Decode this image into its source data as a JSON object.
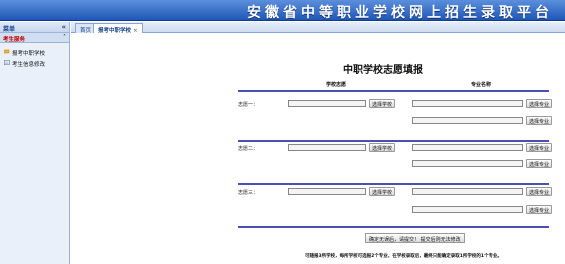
{
  "banner": {
    "title": "安徽省中等职业学校网上招生录取平台"
  },
  "sidebar": {
    "header": "菜单",
    "collapse_icon": "double-chevron-left-icon",
    "group": "考生服务",
    "group_icon": "double-chevron-up-icon",
    "items": [
      {
        "label": "报考中职学校",
        "icon": "pencil-icon"
      },
      {
        "label": "考生信息修改",
        "icon": "edit-form-icon"
      }
    ]
  },
  "tabs": [
    {
      "label": "首页"
    },
    {
      "label": "报考中职学校",
      "close": "×"
    }
  ],
  "form": {
    "title": "中职学校志愿填报",
    "col_school": "学校志愿",
    "col_major": "专业名称",
    "rows": [
      {
        "label": "志愿一：",
        "school_value": "",
        "majors": [
          "",
          ""
        ]
      },
      {
        "label": "志愿二：",
        "school_value": "",
        "majors": [
          "",
          ""
        ]
      },
      {
        "label": "志愿三：",
        "school_value": "",
        "majors": [
          "",
          ""
        ]
      }
    ],
    "select_school_label": "选择学校",
    "select_major_label": "选择专业",
    "submit_label": "确定无误后，请提交！ 提交后则无法修改",
    "note": "可随报3所学校，每所学校可选报2个专业，在学校录取后，最终只能确定录取1所学校的1个专业。"
  },
  "colors": {
    "banner_top": "#5b8fdc",
    "banner_bottom": "#1f57b8",
    "accent_rule": "#4a4fb3",
    "group_text": "#c00000"
  }
}
